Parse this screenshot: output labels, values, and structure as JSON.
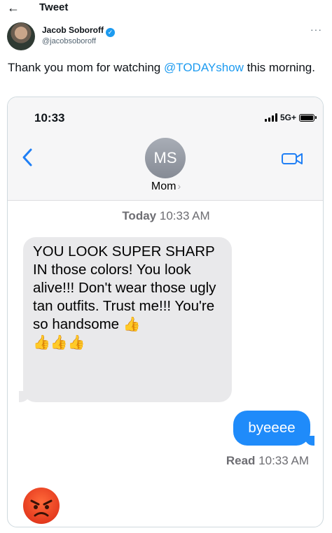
{
  "topbar": {
    "back_icon": "arrow-left-icon",
    "title": "Tweet"
  },
  "author": {
    "name": "Jacob Soboroff",
    "handle": "@jacobsoboroff",
    "verified": true,
    "more_icon": "ellipsis-icon"
  },
  "tweet": {
    "text_before": "Thank you mom for watching ",
    "mention": "@TODAYshow",
    "text_after": " this morning."
  },
  "screenshot": {
    "status_time": "10:33",
    "network": "5G+",
    "contact_initials": "MS",
    "contact_name": "Mom",
    "contact_chevron": "›",
    "timestamp_day": "Today",
    "timestamp_time": "10:33 AM",
    "incoming_text": "YOU LOOK SUPER SHARP IN those colors! You look alive!!! Don't wear those ugly tan outfits.  Trust me!!! You're so handsome",
    "incoming_emoji": "👍",
    "incoming_emoji_row": "👍👍👍",
    "outgoing_text": "byeeee",
    "read_label": "Read",
    "read_time": "10:33 AM",
    "reaction_emoji": "😡"
  },
  "colors": {
    "link": "#1d9bf0",
    "imessage_blue": "#1f8bfa",
    "bubble_gray": "#e9e9eb"
  }
}
